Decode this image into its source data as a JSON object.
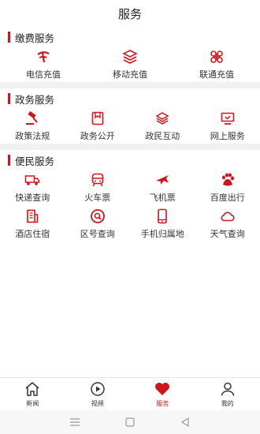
{
  "header": {
    "title": "服务"
  },
  "accent_color": "#d0141b",
  "sections": [
    {
      "title": "缴费服务",
      "items": [
        {
          "label": "电信充值",
          "icon": "telecom-icon"
        },
        {
          "label": "移动充值",
          "icon": "mobile-icon"
        },
        {
          "label": "联通充值",
          "icon": "unicom-icon"
        }
      ]
    },
    {
      "title": "政务服务",
      "items": [
        {
          "label": "政策法规",
          "icon": "gavel-icon"
        },
        {
          "label": "政务公开",
          "icon": "bookmark-icon"
        },
        {
          "label": "政民互动",
          "icon": "layers-icon"
        },
        {
          "label": "网上服务",
          "icon": "monitor-icon"
        }
      ]
    },
    {
      "title": "便民服务",
      "items": [
        {
          "label": "快递查询",
          "icon": "truck-icon"
        },
        {
          "label": "火车票",
          "icon": "train-icon"
        },
        {
          "label": "飞机票",
          "icon": "airplane-icon"
        },
        {
          "label": "百度出行",
          "icon": "baidu-paw-icon"
        },
        {
          "label": "酒店住宿",
          "icon": "hotel-icon"
        },
        {
          "label": "区号查询",
          "icon": "search-circle-icon"
        },
        {
          "label": "手机归属地",
          "icon": "phone-icon"
        },
        {
          "label": "天气查询",
          "icon": "cloud-icon"
        }
      ]
    }
  ],
  "tabbar": {
    "items": [
      {
        "label": "新闻",
        "icon": "home-icon"
      },
      {
        "label": "视频",
        "icon": "play-icon"
      },
      {
        "label": "服务",
        "icon": "heart-icon",
        "active": true
      },
      {
        "label": "我的",
        "icon": "user-icon"
      }
    ]
  }
}
